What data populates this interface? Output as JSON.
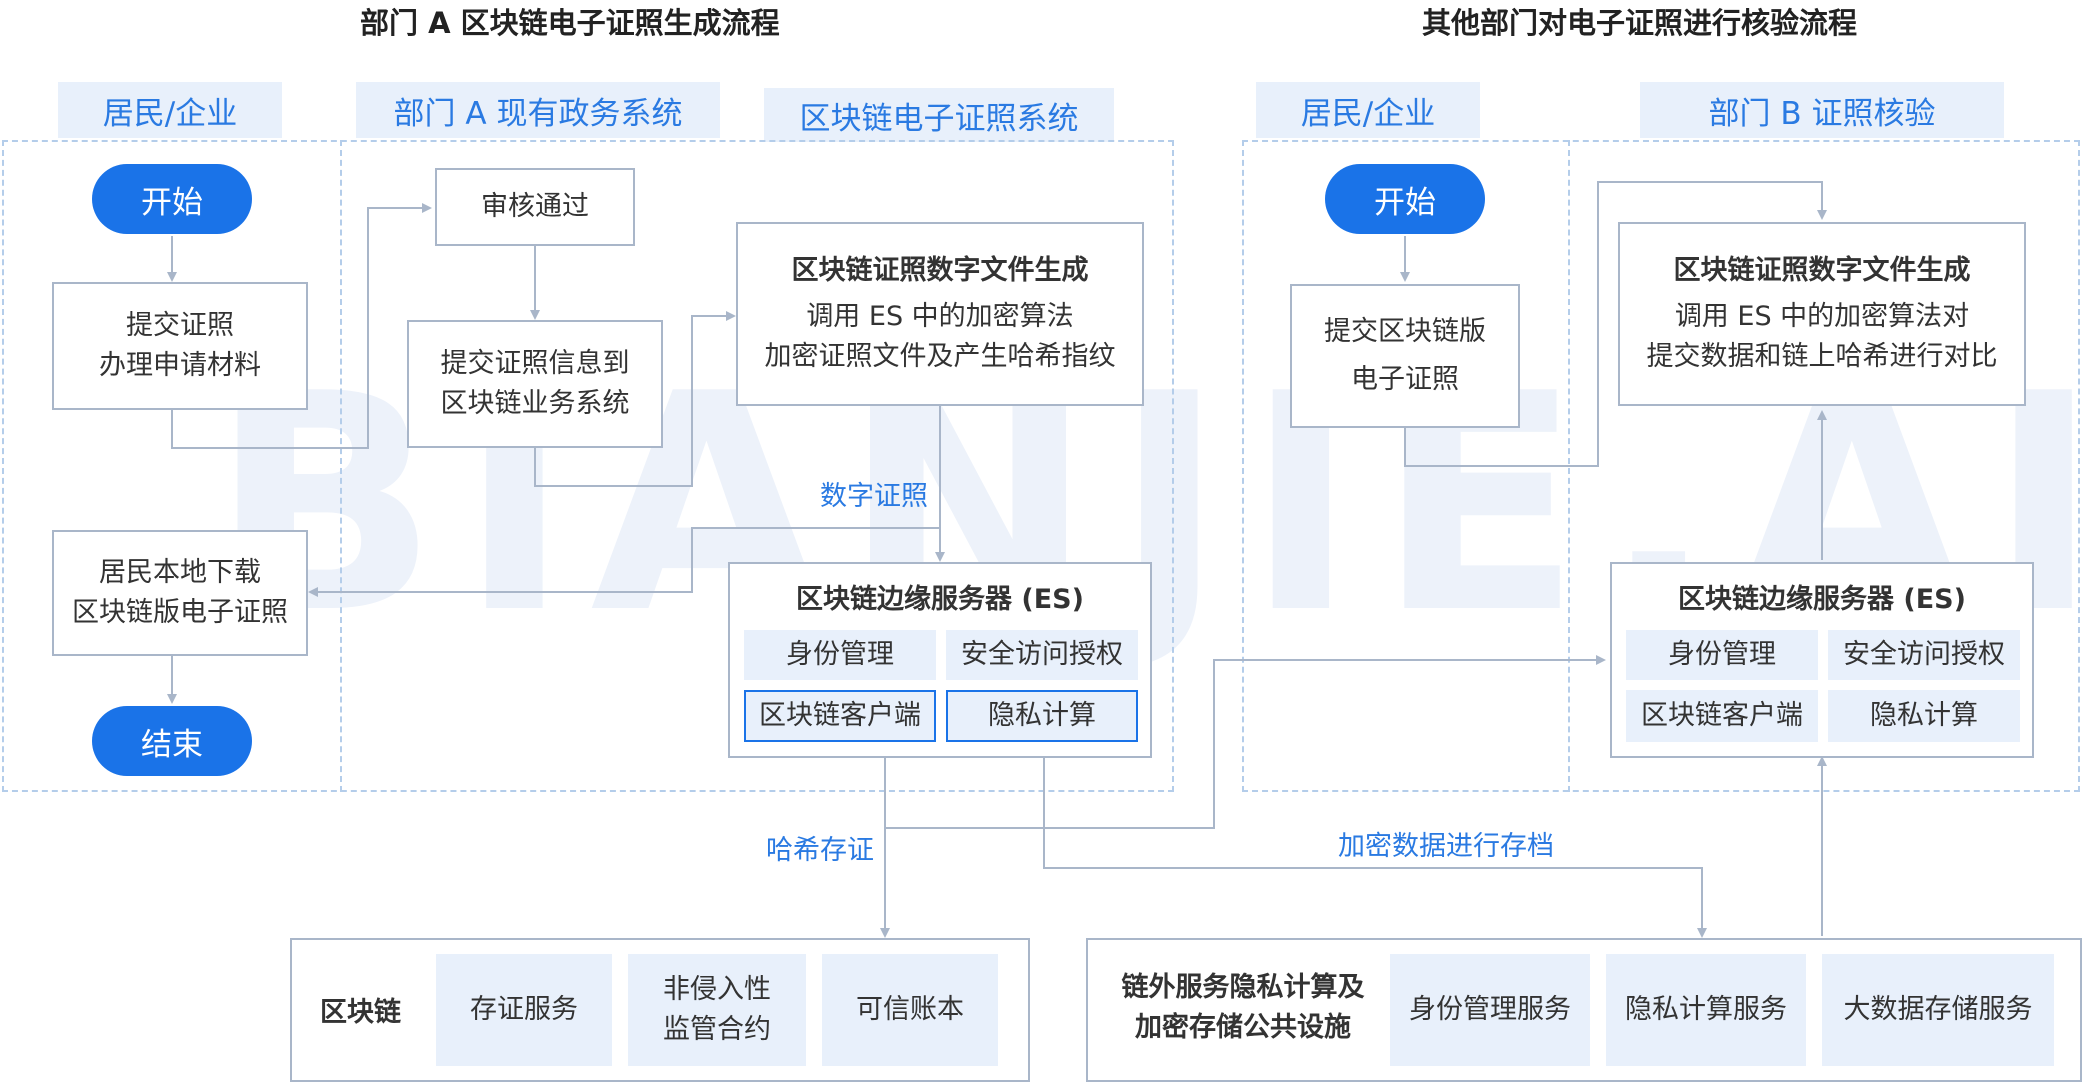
{
  "watermark": "BIANJIE.AI",
  "titles": {
    "left": "部门 A 区块链电子证照生成流程",
    "right": "其他部门对电子证照进行核验流程"
  },
  "lanes": {
    "resident_a": "居民/企业",
    "gov_a": "部门 A 现有政务系统",
    "chain_sys": "区块链电子证照系统",
    "resident_b": "居民/企业",
    "verify_b": "部门 B 证照核验"
  },
  "left": {
    "start": "开始",
    "submit_1": "提交证照",
    "submit_2": "办理申请材料",
    "download_1": "居民本地下载",
    "download_2": "区块链版电子证照",
    "end": "结束",
    "approve": "审核通过",
    "submitinfo_1": "提交证照信息到",
    "submitinfo_2": "区块链业务系统",
    "gen_title": "区块链证照数字文件生成",
    "gen_1": "调用 ES 中的加密算法",
    "gen_2": "加密证照文件及产生哈希指纹",
    "digital_cert": "数字证照",
    "es_title": "区块链边缘服务器 (ES)",
    "es_cells": [
      "身份管理",
      "安全访问授权",
      "区块链客户端",
      "隐私计算"
    ]
  },
  "right": {
    "start": "开始",
    "submit_1": "提交区块链版",
    "submit_2": "电子证照",
    "gen_title": "区块链证照数字文件生成",
    "gen_1": "调用 ES 中的加密算法对",
    "gen_2": "提交数据和链上哈希进行对比",
    "es_title": "区块链边缘服务器 (ES)",
    "es_cells": [
      "身份管理",
      "安全访问授权",
      "区块链客户端",
      "隐私计算"
    ]
  },
  "links": {
    "hash": "哈希存证",
    "archive": "加密数据进行存档"
  },
  "bottom_left": {
    "title": "区块链",
    "cells": [
      "存证服务",
      "非侵入性",
      "监管合约",
      "可信账本"
    ]
  },
  "bottom_right": {
    "title_1": "链外服务隐私计算及",
    "title_2": "加密存储公共设施",
    "cells": [
      "身份管理服务",
      "隐私计算服务",
      "大数据存储服务"
    ]
  }
}
